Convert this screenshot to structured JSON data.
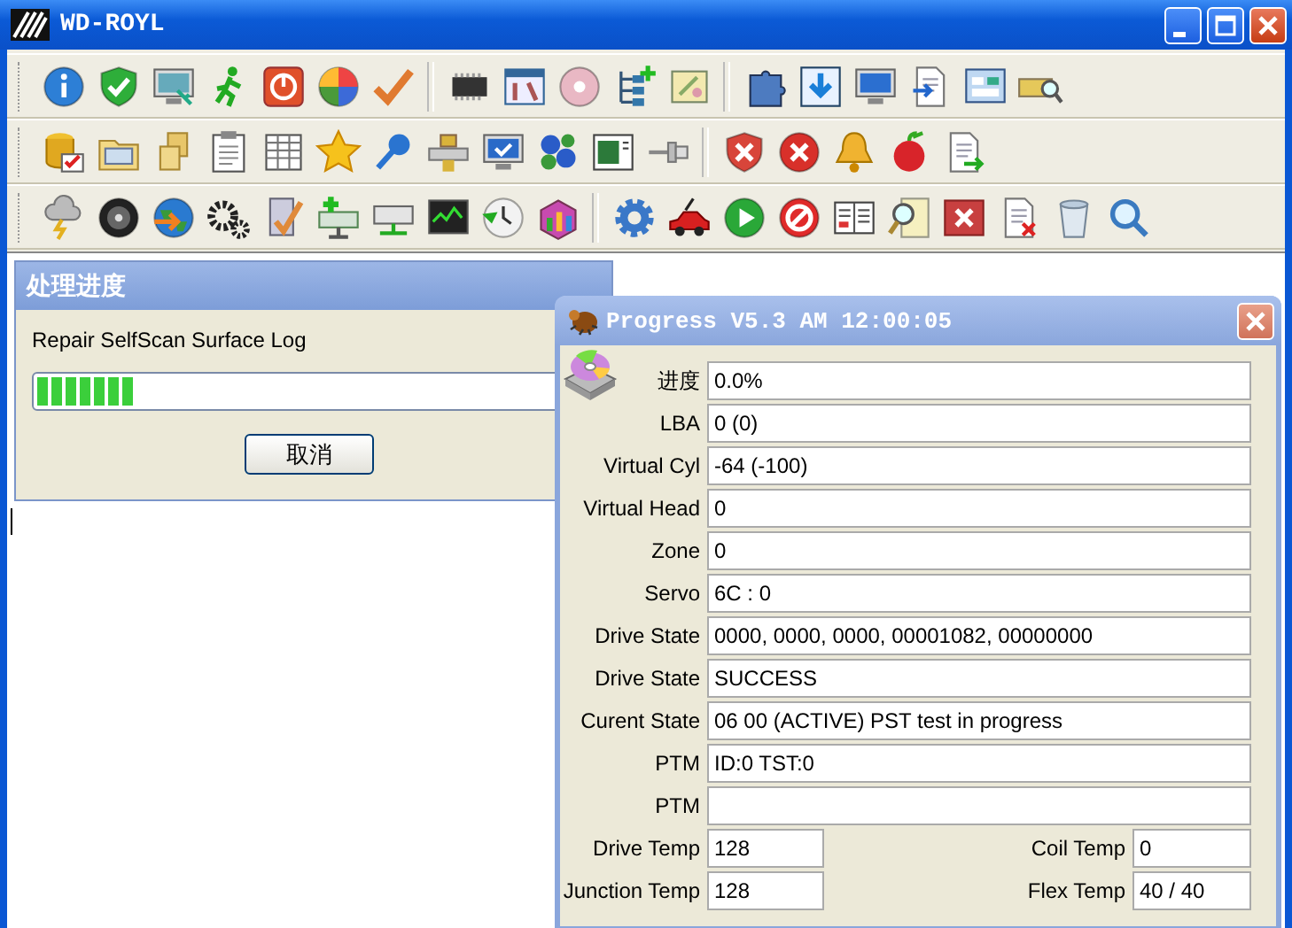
{
  "window": {
    "title": "WD-ROYL"
  },
  "progress_dialog": {
    "title": "处理进度",
    "message": "Repair SelfScan Surface Log",
    "progress": {
      "level": 0.18
    },
    "buttons": [
      "取消"
    ]
  },
  "progress_window": {
    "title": "Progress V5.3 AM 12:00:05",
    "fields": [
      {
        "label": "进度",
        "value": "0.0%"
      },
      {
        "label": "LBA",
        "value": "0  (0)"
      },
      {
        "label": "Virtual Cyl",
        "value": "-64  (-100)"
      },
      {
        "label": "Virtual Head",
        "value": "0"
      },
      {
        "label": "Zone",
        "value": "0"
      },
      {
        "label": "Servo",
        "value": "6C : 0"
      },
      {
        "label": "Drive State",
        "value": "0000, 0000, 0000, 00001082, 00000000"
      },
      {
        "label": "Drive State",
        "value": "SUCCESS"
      },
      {
        "label": "Curent State",
        "value": "06 00 (ACTIVE) PST test in progress"
      },
      {
        "label": "PTM",
        "value": "ID:0  TST:0"
      },
      {
        "label": "PTM"
      }
    ],
    "temperatures": [
      {
        "label": "Drive Temp",
        "value": "128"
      },
      {
        "label": "Coil Temp",
        "value": "0"
      },
      {
        "label": "Junction Temp",
        "value": "128"
      },
      {
        "label": "Flex Temp",
        "value": "40 / 40"
      }
    ]
  }
}
